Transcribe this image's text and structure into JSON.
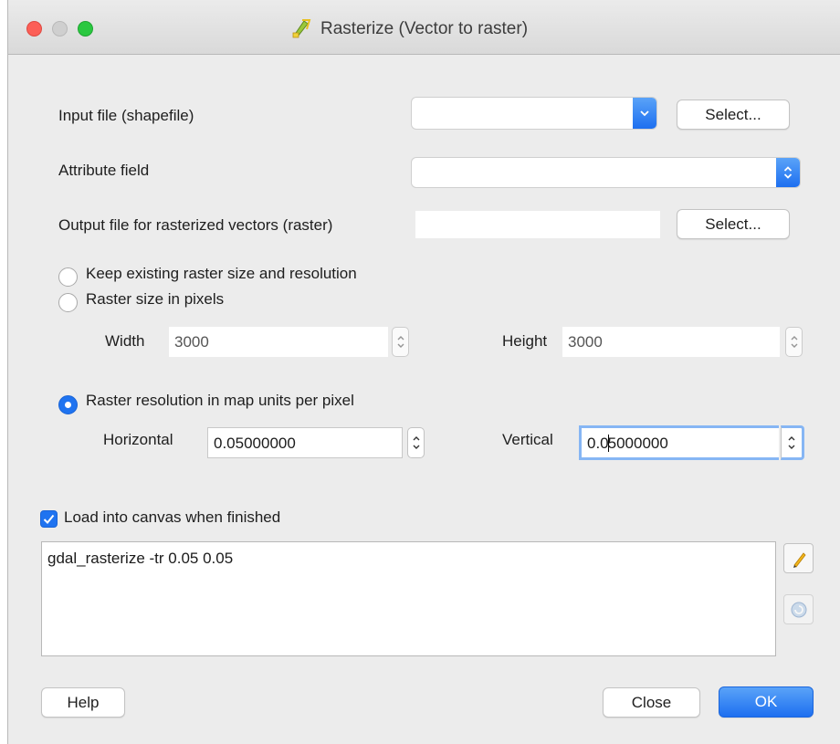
{
  "window": {
    "title": "Rasterize (Vector to raster)"
  },
  "form": {
    "input_label": "Input file (shapefile)",
    "input_value": "",
    "input_select_label": "Select...",
    "attribute_label": "Attribute field",
    "attribute_value": "",
    "output_label": "Output file for rasterized vectors (raster)",
    "output_value": "",
    "output_select_label": "Select..."
  },
  "options": {
    "keep_label": "Keep existing raster size and resolution",
    "size_label": "Raster size in pixels",
    "width_label": "Width",
    "width_value": "3000",
    "height_label": "Height",
    "height_value": "3000",
    "resolution_label": "Raster resolution in map units per pixel",
    "selected": "resolution",
    "horizontal_label": "Horizontal",
    "horizontal_value": "0.05000000",
    "vertical_label": "Vertical",
    "vertical_value_before_caret": "0.0",
    "vertical_value_after_caret": "5000000"
  },
  "load_canvas": {
    "label": "Load into canvas when finished",
    "checked": true
  },
  "command": {
    "text": "gdal_rasterize -tr 0.05 0.05",
    "edit_icon": "pencil-icon",
    "reset_icon": "reset-icon"
  },
  "footer": {
    "help_label": "Help",
    "close_label": "Close",
    "ok_label": "OK"
  },
  "colors": {
    "accent": "#1f73f0",
    "close_button": "#fc5f57",
    "zoom_button": "#2ac840"
  }
}
